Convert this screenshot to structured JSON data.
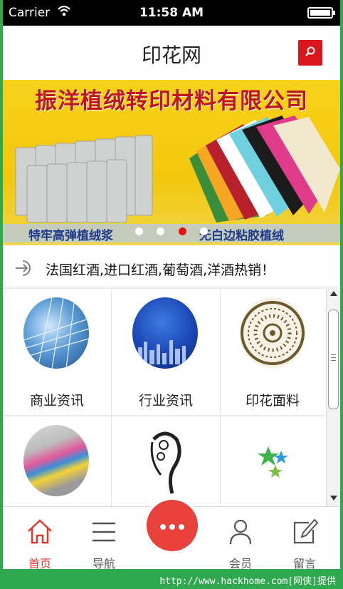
{
  "status_bar": {
    "carrier": "Carrier",
    "time": "11:58 AM"
  },
  "header": {
    "title": "印花网",
    "search_icon": "search-icon"
  },
  "banner": {
    "company": "振洋植绒转印材料有限公司",
    "slogan_left": "特牢高弹植绒浆",
    "slogan_right": "无白边粘胶植绒",
    "slide_count": 4,
    "active_slide": 3
  },
  "notice": {
    "text": "法国红酒,进口红酒,葡萄酒,洋酒热销！",
    "icon": "login-arrow-icon"
  },
  "grid": {
    "items": [
      {
        "label": "商业资讯",
        "icon": "business-news-icon"
      },
      {
        "label": "行业资讯",
        "icon": "industry-news-icon"
      },
      {
        "label": "印花面料",
        "icon": "print-fabric-icon"
      },
      {
        "label": "",
        "icon": "color-ribbon-icon"
      },
      {
        "label": "",
        "icon": "swan-pattern-icon"
      },
      {
        "label": "",
        "icon": "green-stars-icon"
      }
    ]
  },
  "tabbar": {
    "home": "首页",
    "nav": "导航",
    "member": "会员",
    "message": "留言",
    "center_icon": "more-dots-icon"
  },
  "colors": {
    "accent": "#e23a2f",
    "brand_red": "#d9161c",
    "banner_yellow": "#f3c70d"
  },
  "watermark": "http://www.hackhome.com[网侠]提供"
}
